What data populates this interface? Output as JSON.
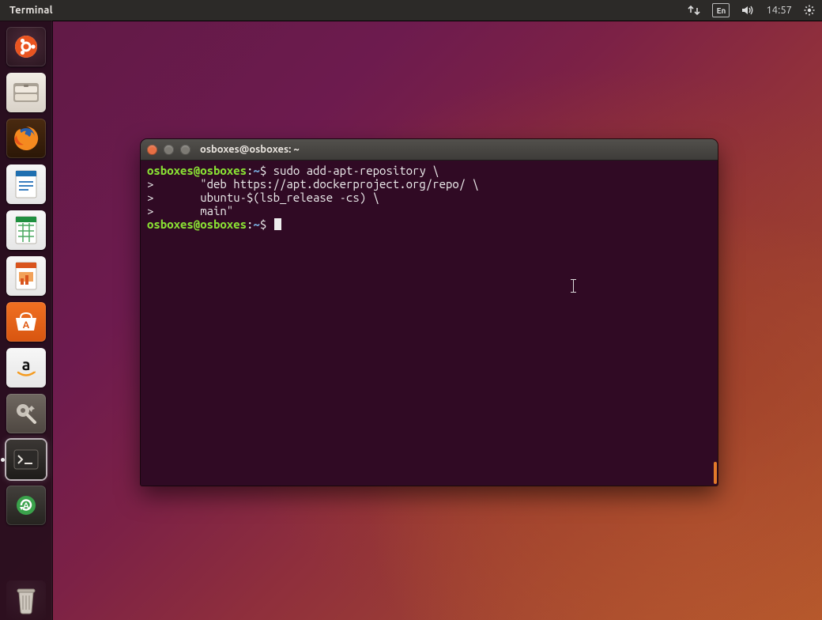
{
  "topbar": {
    "app_title": "Terminal",
    "language_indicator": "En",
    "clock": "14:57"
  },
  "launcher": {
    "items": [
      {
        "name": "Dash",
        "icon": "ubuntu",
        "running": false
      },
      {
        "name": "Files",
        "icon": "files",
        "running": false
      },
      {
        "name": "Firefox",
        "icon": "firefox",
        "running": false
      },
      {
        "name": "LibreOffice Writer",
        "icon": "writer",
        "running": false
      },
      {
        "name": "LibreOffice Calc",
        "icon": "calc",
        "running": false
      },
      {
        "name": "LibreOffice Impress",
        "icon": "impress",
        "running": false
      },
      {
        "name": "Ubuntu Software",
        "icon": "software",
        "running": false
      },
      {
        "name": "Amazon",
        "icon": "amazon",
        "running": false
      },
      {
        "name": "System Settings",
        "icon": "settings",
        "running": false
      },
      {
        "name": "Terminal",
        "icon": "terminal",
        "running": true
      },
      {
        "name": "Software Updater",
        "icon": "updater",
        "running": false
      }
    ],
    "trash_label": "Trash"
  },
  "terminal": {
    "window_title": "osboxes@osboxes: ~",
    "prompt": {
      "user": "osboxes@osboxes",
      "sep": ":",
      "path": "~",
      "end": "$ "
    },
    "continuation_prefix": ">       ",
    "lines": [
      {
        "type": "prompt",
        "text": "sudo add-apt-repository \\"
      },
      {
        "type": "cont",
        "text": "\"deb https://apt.dockerproject.org/repo/ \\"
      },
      {
        "type": "cont",
        "text": "ubuntu-$(lsb_release -cs) \\"
      },
      {
        "type": "cont",
        "text": "main\""
      },
      {
        "type": "prompt",
        "text": "",
        "cursor": true
      }
    ]
  }
}
